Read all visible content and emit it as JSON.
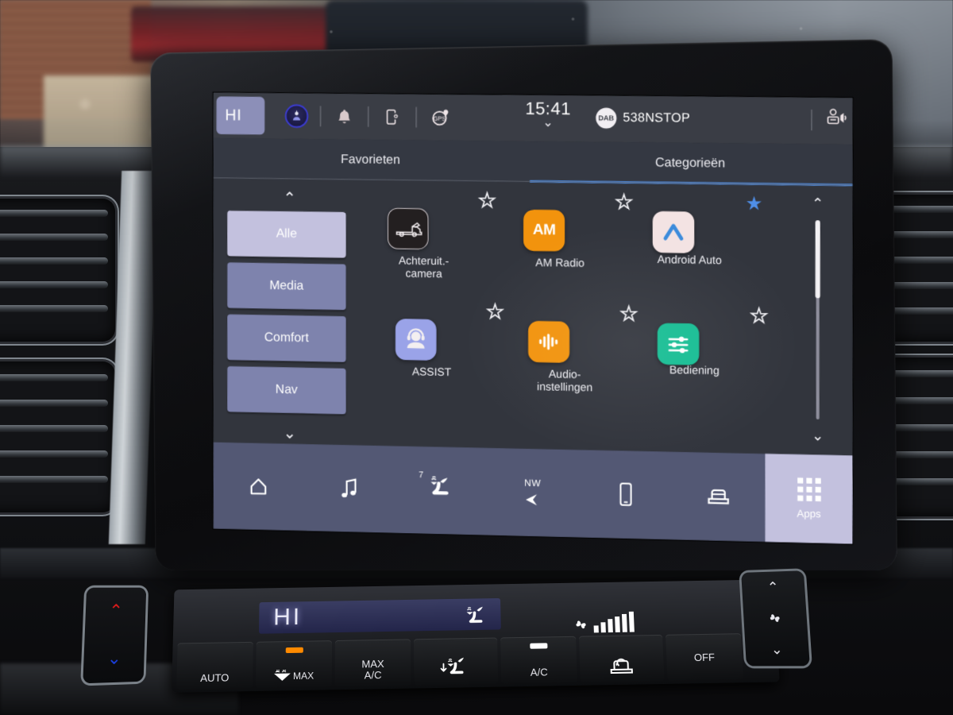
{
  "screen": {
    "status_bar": {
      "temperature": "HI",
      "icons": [
        "user-avatar-icon",
        "bell-icon",
        "phone-settings-icon",
        "gps-icon"
      ],
      "clock": "15:41",
      "clock_chevron": "⌄",
      "media_badge": "DAB",
      "media_station": "538NSTOP",
      "right_icon": "voice-volume-icon"
    },
    "tabs": [
      {
        "label": "Favorieten",
        "active": false
      },
      {
        "label": "Categorieën",
        "active": true
      }
    ],
    "categories": {
      "up_arrow": "⌃",
      "down_arrow": "⌄",
      "items": [
        {
          "label": "Alle",
          "active": true
        },
        {
          "label": "Media",
          "active": false
        },
        {
          "label": "Comfort",
          "active": false
        },
        {
          "label": "Nav",
          "active": false
        }
      ]
    },
    "apps": [
      {
        "label": "Achteruit.-\ncamera",
        "icon": "rear-view-camera-icon",
        "favorite": false,
        "icon_bg": "#231f20"
      },
      {
        "label": "AM Radio",
        "icon": "am-radio-icon",
        "favorite": false,
        "icon_bg": "#f2930d",
        "icon_text": "AM"
      },
      {
        "label": "Android Auto",
        "icon": "android-auto-icon",
        "favorite": true,
        "icon_bg": "#f2e2e2"
      },
      {
        "label": "ASSIST",
        "icon": "assist-headset-icon",
        "favorite": false,
        "icon_bg": "#9aa3e8"
      },
      {
        "label": "Audio-\ninstellingen",
        "icon": "audio-settings-icon",
        "favorite": false,
        "icon_bg": "#f2930d"
      },
      {
        "label": "Bediening",
        "icon": "vehicle-controls-icon",
        "favorite": false,
        "icon_bg": "#16bd93"
      }
    ],
    "scrollbar": {
      "up_arrow": "⌃",
      "down_arrow": "⌄",
      "thumb_position_pct": 0
    },
    "bottom_nav": [
      {
        "name": "home",
        "icon": "home-icon",
        "label": ""
      },
      {
        "name": "media",
        "icon": "music-note-icon",
        "label": ""
      },
      {
        "name": "climate",
        "icon": "heated-seat-icon",
        "label": "7"
      },
      {
        "name": "navigation",
        "icon": "compass-arrow-icon",
        "label": "NW"
      },
      {
        "name": "phone",
        "icon": "smartphone-icon",
        "label": ""
      },
      {
        "name": "vehicle",
        "icon": "car-icon",
        "label": ""
      }
    ],
    "apps_button": {
      "label": "Apps",
      "icon": "grid-apps-icon",
      "active": true
    },
    "colors": {
      "accent_blue": "#4f8fe8",
      "panel_bg": "#32353d",
      "status_bar_bg": "#3a3d45",
      "nav_bar_bg": "#535874",
      "highlight": "#c3c1de"
    }
  },
  "climate_panel": {
    "display_temp": "HI",
    "display_icons": [
      "windshield-defrost-icon",
      "fan-icon"
    ],
    "fan_level_bars": 6,
    "buttons": [
      {
        "label": "AUTO",
        "led": "none"
      },
      {
        "label": "MAX",
        "icon": "max-defrost-icon",
        "led": "#ff8a00"
      },
      {
        "label": "MAX\nA/C",
        "led": "none"
      },
      {
        "label": "",
        "icon": "rear-defrost-icon",
        "led": "none"
      },
      {
        "label": "A/C",
        "led": "#ffffff"
      },
      {
        "label": "",
        "icon": "recirculate-air-icon",
        "led": "none"
      },
      {
        "label": "OFF",
        "led": "none"
      }
    ],
    "temp_rocker": {
      "up": "⌃",
      "down": "⌄",
      "up_color": "#e01b1b",
      "down_color": "#1b3fe0"
    },
    "fan_rocker": {
      "up": "⌃",
      "icon": "fan-icon",
      "down": "⌄"
    }
  }
}
